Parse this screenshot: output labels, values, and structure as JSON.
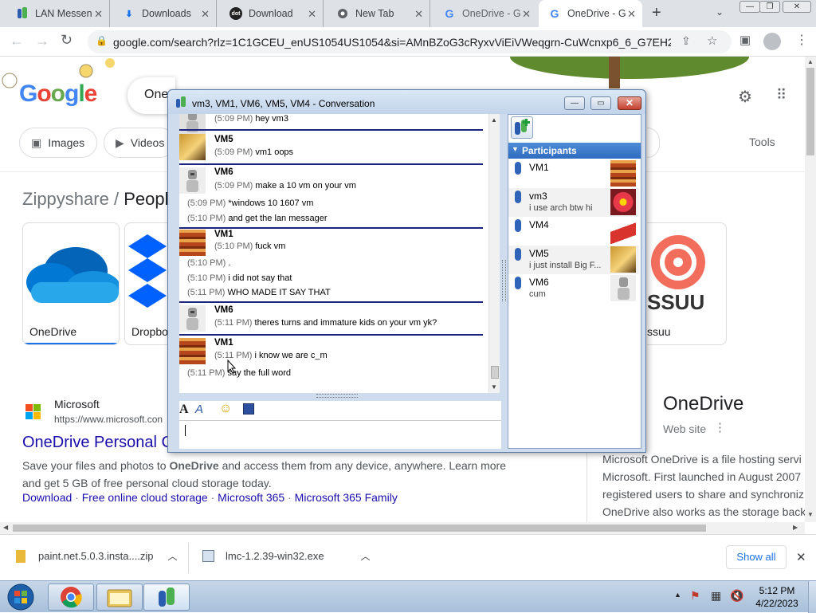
{
  "browser": {
    "tabs": [
      {
        "label": "LAN Messen",
        "icon": "lan-messenger-icon"
      },
      {
        "label": "Downloads",
        "icon": "download-icon"
      },
      {
        "label": "Download",
        "icon": "dot-icon",
        "icon_text": "dot"
      },
      {
        "label": "New Tab",
        "icon": "chrome-icon"
      },
      {
        "label": "OneDrive - G",
        "icon": "google-icon"
      },
      {
        "label": "OneDrive - G",
        "icon": "google-icon"
      }
    ],
    "url": "google.com/search?rlz=1C1GCEU_enUS1054US1054&si=AMnBZoG3cRyxvViEiVWeqgrn-CuWcnxp6_6_G7EH225..."
  },
  "google": {
    "logo": "Google",
    "search_query": "One",
    "chips": [
      "Images",
      "Videos"
    ],
    "tools": "Tools",
    "breadcrumb_prefix": "Zippyshare",
    "breadcrumb_sep": "/",
    "breadcrumb_current": "People",
    "cards": [
      {
        "label": "OneDrive"
      },
      {
        "label": "Dropbo"
      },
      {
        "label": "ssuu",
        "logo_text": "SSUU"
      }
    ],
    "result": {
      "site": "Microsoft",
      "url": "https://www.microsoft.con",
      "title": "OneDrive Personal C",
      "snippet_a": "Save your files and photos to ",
      "snippet_b": "OneDrive",
      "snippet_c": " and access them from any device, anywhere. Learn more",
      "snippet_d": "and get 5 GB of free personal cloud storage today.",
      "links": [
        "Download",
        "Free online cloud storage",
        "Microsoft 365",
        "Microsoft 365 Family"
      ]
    },
    "kp": {
      "title": "OneDrive",
      "subtitle": "Web site",
      "lines": [
        "Microsoft OneDrive is a file hosting servi",
        "Microsoft. First launched in August 2007",
        "registered users to share and synchroniz",
        "OneDrive also works as the storage back"
      ]
    }
  },
  "downloads": {
    "items": [
      {
        "name": "paint.net.5.0.3.insta....zip"
      },
      {
        "name": "lmc-1.2.39-win32.exe"
      }
    ],
    "show_all": "Show all"
  },
  "taskbar": {
    "time": "5:12 PM",
    "date": "4/22/2023"
  },
  "messenger": {
    "title": "vm3, VM1, VM6, VM5, VM4 - Conversation",
    "participants_header": "Participants",
    "messages": [
      {
        "lines": [
          {
            "time": "(5:09 PM)",
            "text": "hey vm3"
          }
        ]
      },
      {
        "sender": "VM5",
        "lines": [
          {
            "time": "(5:09 PM)",
            "text": "vm1 oops"
          }
        ]
      },
      {
        "sender": "VM6",
        "lines": [
          {
            "time": "(5:09 PM)",
            "text": "make a 10 vm on your vm"
          },
          {
            "time": "(5:09 PM)",
            "text": "*windows 10 1607 vm"
          },
          {
            "time": "(5:10 PM)",
            "text": "and get the lan messager"
          }
        ]
      },
      {
        "sender": "VM1",
        "lines": [
          {
            "time": "(5:10 PM)",
            "text": "fuck vm"
          },
          {
            "time": "(5:10 PM)",
            "text": "."
          },
          {
            "time": "(5:10 PM)",
            "text": "i did not say that"
          },
          {
            "time": "(5:11 PM)",
            "text": "WHO MADE IT SAY THAT"
          }
        ]
      },
      {
        "sender": "VM6",
        "lines": [
          {
            "time": "(5:11 PM)",
            "text": "theres turns and immature kids on your vm yk?"
          }
        ]
      },
      {
        "sender": "VM1",
        "lines": [
          {
            "time": "(5:11 PM)",
            "text": "i know we are c_m"
          },
          {
            "time": "(5:11 PM)",
            "text": "say the full word"
          }
        ]
      }
    ],
    "participants": [
      {
        "name": "VM1",
        "status": ""
      },
      {
        "name": "vm3",
        "status": "i use arch btw hi"
      },
      {
        "name": "VM4",
        "status": ""
      },
      {
        "name": "VM5",
        "status": "i just install Big F..."
      },
      {
        "name": "VM6",
        "status": "cum"
      }
    ]
  }
}
